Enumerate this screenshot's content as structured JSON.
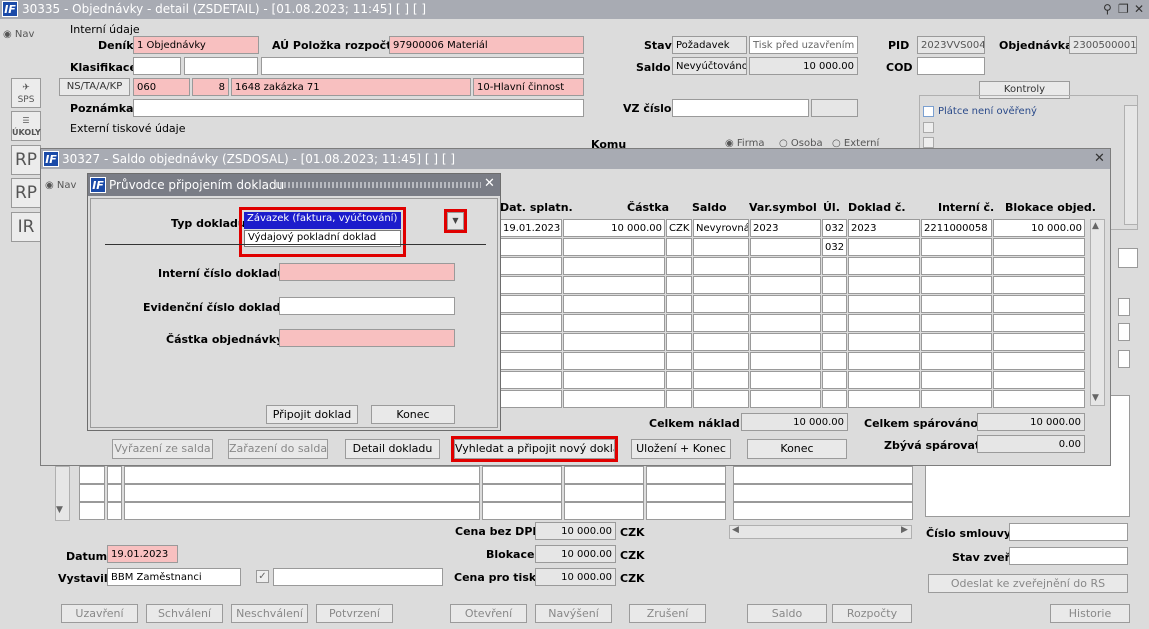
{
  "main_window": {
    "title": "30335 - Objednávky - detail (ZSDETAIL) - [01.08.2023; 11:45]  [ ]  [ ]",
    "logo": "IF",
    "ctrl_icons": [
      "pin-icon",
      "restore-icon",
      "close-icon"
    ]
  },
  "nav_label": "Nav",
  "section_internal": "Interní údaje",
  "section_external": "Externí tiskové údaje",
  "fields": {
    "denik_label": "Deník",
    "denik_value": "1 Objednávky",
    "au_label": "AÚ Položka rozpočtu",
    "au_value": "97900006 Materiál",
    "klasifikace_label": "Klasifikace",
    "ns_label": "NS/TA/A/KP",
    "ns_1": "060",
    "ns_2": "8",
    "ns_3": "1648 zakázka 71",
    "ns_4": "10-Hlavní činnost",
    "poznamka_label": "Poznámka",
    "stav_label": "Stav",
    "stav_value": "Požadavek",
    "stav_value2": "Tisk před uzavřením",
    "saldo_label": "Saldo",
    "saldo_value": "Nevyúčtováno",
    "saldo_amount": "10 000.00",
    "vz_label": "VZ číslo",
    "pid_label": "PID",
    "pid_value": "2023VVS004",
    "objednavka_label": "Objednávka",
    "objednavka_value": "2300500001",
    "cod_label": "COD"
  },
  "kontroly_button": "Kontroly",
  "platce_label": "Plátce není ověřený",
  "side_icons": [
    "SPS",
    "ÚKOLY",
    "RP",
    "RP",
    "IR"
  ],
  "komu_label": "Komu",
  "komu_options": [
    "Firma",
    "Osoba",
    "Externí"
  ],
  "saldo_window": {
    "title": "30327 - Saldo objednávky (ZSDOSAL) - [01.08.2023; 11:45]  [ ]  [ ]",
    "nav": "Nav",
    "headers": [
      "Dat. splatn.",
      "Částka",
      "Saldo",
      "Var.symbol",
      "Úl.",
      "Doklad č.",
      "Interní č.",
      "Blokace objed."
    ],
    "row1": {
      "date": "19.01.2023",
      "amount": "10 000.00",
      "cur": "CZK",
      "saldo": "Nevyrovná",
      "vs": "2023",
      "ul": "032",
      "doklad": "2023",
      "interni": "2211000058",
      "blokace": "10 000.00"
    },
    "row2_ul": "032",
    "celkem_naklad_label": "Celkem náklad",
    "celkem_naklad": "10 000.00",
    "celkem_sparovano_label": "Celkem spárováno",
    "celkem_sparovano": "10 000.00",
    "zbyva_label": "Zbývá spárovat",
    "zbyva": "0.00",
    "buttons": {
      "vyrazeni": "Vyřazení ze salda",
      "zarazeni": "Zařazení do salda",
      "detail": "Detail dokladu",
      "vyhledat": "Vyhledat a připojit nový doklad",
      "ulozeni": "Uložení + Konec",
      "konec": "Konec"
    }
  },
  "dialog": {
    "title": "Průvodce připojením dokladu",
    "typ_label": "Typ dokladu",
    "typ_options": [
      "Závazek (faktura, vyúčtování)",
      "Výdajový pokladní doklad"
    ],
    "interni_label": "Interní číslo dokladu",
    "evidencni_label": "Evidenční číslo dokladu",
    "castka_label": "Částka objednávky",
    "pripojit": "Připojit doklad",
    "konec": "Konec"
  },
  "bottom": {
    "cena_bez_dph_label": "Cena bez DPH",
    "cena_bez_dph": "10 000.00",
    "blokace_label": "Blokace",
    "blokace": "10 000.00",
    "cena_pro_tisk_label": "Cena pro tisk",
    "cena_pro_tisk": "10 000.00",
    "currency": "CZK",
    "datum_label": "Datum",
    "datum_value": "19.01.2023",
    "vystavil_label": "Vystavil",
    "vystavil_value": "BBM Zaměstnanci",
    "cislo_smlouvy_label": "Číslo smlouvy",
    "stav_zver_label": "Stav zveř.",
    "odeslat": "Odeslat ke zveřejnění do RS"
  },
  "bottom_buttons": [
    "Uzavření",
    "Schválení",
    "Neschválení",
    "Potvrzení",
    "Otevření",
    "Navýšení",
    "Zrušení",
    "Saldo",
    "Rozpočty",
    "Historie"
  ]
}
